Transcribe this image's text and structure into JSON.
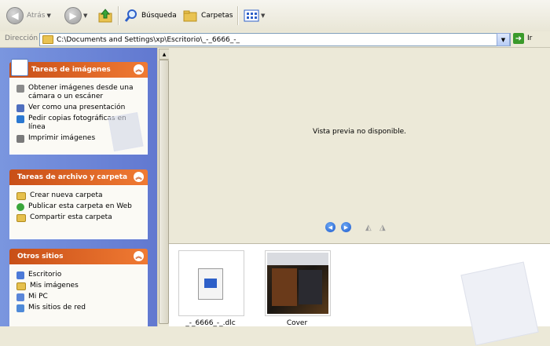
{
  "toolbar": {
    "back_label": "Atrás",
    "search_label": "Búsqueda",
    "folders_label": "Carpetas"
  },
  "address": {
    "label": "Dirección",
    "value": "C:\\Documents and Settings\\xp\\Escritorio\\_-_6666_-_",
    "go_label": "Ir"
  },
  "sidebar": {
    "image_tasks": {
      "title": "Tareas de imágenes",
      "items": [
        {
          "label": "Obtener imágenes desde una cámara o un escáner",
          "icon": "camera-icon"
        },
        {
          "label": "Ver como una presentación",
          "icon": "slideshow-icon"
        },
        {
          "label": "Pedir copias fotográficas en línea",
          "icon": "order-prints-icon"
        },
        {
          "label": "Imprimir imágenes",
          "icon": "printer-icon"
        }
      ]
    },
    "file_tasks": {
      "title": "Tareas de archivo y carpeta",
      "items": [
        {
          "label": "Crear nueva carpeta",
          "icon": "new-folder-icon"
        },
        {
          "label": "Publicar esta carpeta en Web",
          "icon": "publish-web-icon"
        },
        {
          "label": "Compartir esta carpeta",
          "icon": "share-folder-icon"
        }
      ]
    },
    "other_places": {
      "title": "Otros sitios",
      "items": [
        {
          "label": "Escritorio",
          "icon": "desktop-icon"
        },
        {
          "label": "Mis imágenes",
          "icon": "my-pictures-icon"
        },
        {
          "label": "Mi PC",
          "icon": "my-computer-icon"
        },
        {
          "label": "Mis sitios de red",
          "icon": "network-places-icon"
        }
      ]
    }
  },
  "preview": {
    "message": "Vista previa no disponible."
  },
  "files": [
    {
      "name": "_-_6666_-_.dlc",
      "type": "document"
    },
    {
      "name": "Cover",
      "type": "image"
    }
  ],
  "colors": {
    "panel_header_start": "#c84f17",
    "panel_header_end": "#f07a33",
    "sidebar_bg": "#6f8ad8",
    "chrome_bg": "#ece9d8"
  }
}
